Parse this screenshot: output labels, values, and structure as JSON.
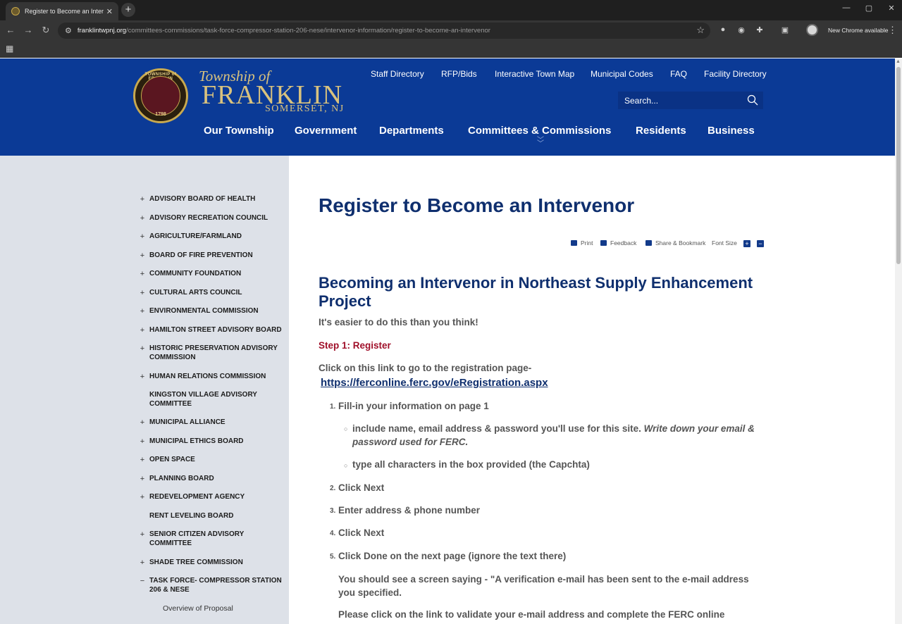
{
  "browser": {
    "tab_title": "Register to Become an Intervenor",
    "url_domain": "franklintwpnj.org",
    "url_path": "/committees-commissions/task-force-compressor-station-206-nese/intervenor-information/register-to-become-an-intervenor",
    "new_chrome_label": "New Chrome available"
  },
  "header": {
    "logo_township": "Township of",
    "logo_franklin": "FRANKLIN",
    "logo_somerset": "SOMERSET, NJ",
    "seal_text": "TOWNSHIP of FRANKLIN",
    "seal_year": "1798",
    "utility_links": [
      "Staff Directory",
      "RFP/Bids",
      "Interactive Town Map",
      "Municipal Codes",
      "FAQ",
      "Facility Directory"
    ],
    "search_placeholder": "Search...",
    "main_nav": [
      "Our Township",
      "Government",
      "Departments",
      "Committees & Commissions",
      "Residents",
      "Business"
    ]
  },
  "sidebar": {
    "items": [
      {
        "label": "ADVISORY BOARD OF HEALTH",
        "marker": "+"
      },
      {
        "label": "ADVISORY RECREATION COUNCIL",
        "marker": "+"
      },
      {
        "label": "AGRICULTURE/FARMLAND",
        "marker": "+"
      },
      {
        "label": "BOARD OF FIRE PREVENTION",
        "marker": "+"
      },
      {
        "label": "COMMUNITY FOUNDATION",
        "marker": "+"
      },
      {
        "label": "CULTURAL ARTS COUNCIL",
        "marker": "+"
      },
      {
        "label": "ENVIRONMENTAL COMMISSION",
        "marker": "+"
      },
      {
        "label": "HAMILTON STREET ADVISORY BOARD",
        "marker": "+"
      },
      {
        "label": "HISTORIC PRESERVATION ADVISORY COMMISSION",
        "marker": "+"
      },
      {
        "label": "HUMAN RELATIONS COMMISSION",
        "marker": "+"
      },
      {
        "label": "KINGSTON VILLAGE ADVISORY COMMITTEE",
        "marker": ""
      },
      {
        "label": "MUNICIPAL ALLIANCE",
        "marker": "+"
      },
      {
        "label": "MUNICIPAL ETHICS BOARD",
        "marker": "+"
      },
      {
        "label": "OPEN SPACE",
        "marker": "+"
      },
      {
        "label": "PLANNING BOARD",
        "marker": "+"
      },
      {
        "label": "REDEVELOPMENT AGENCY",
        "marker": "+"
      },
      {
        "label": "RENT LEVELING BOARD",
        "marker": ""
      },
      {
        "label": "SENIOR CITIZEN ADVISORY COMMITTEE",
        "marker": "+"
      },
      {
        "label": "SHADE TREE COMMISSION",
        "marker": "+"
      },
      {
        "label": "TASK FORCE- COMPRESSOR STATION 206 & NESE",
        "marker": "−"
      }
    ],
    "sub_item": "Overview of Proposal"
  },
  "page": {
    "title": "Register to Become an Intervenor",
    "tools": {
      "print": "Print",
      "feedback": "Feedback",
      "share": "Share & Bookmark",
      "font_size": "Font Size",
      "plus": "+",
      "minus": "−"
    },
    "heading": "Becoming an Intervenor in Northeast Supply Enhancement Project",
    "intro": "It's easier to do this than you think!",
    "step1": "Step 1: Register",
    "click_link_text": "Click on this link to go to the registration page-",
    "registration_url": "https://ferconline.ferc.gov/eRegistration.aspx",
    "steps": [
      "Fill-in your information on page 1",
      "Click Next",
      "Enter address & phone number",
      "Click Next",
      "Click Done on the next page (ignore the text there)"
    ],
    "step_numbers": [
      "1.",
      "2.",
      "3.",
      "4.",
      "5."
    ],
    "sub_bullet_1": "include name, email address & password you'll use for this site. ",
    "sub_bullet_1_italic": "Write down your email & password used for FERC.",
    "sub_bullet_2": "type all characters in the box provided (the Capchta)",
    "verification_text": "You should see a screen saying - \"A verification e-mail has been sent to the e-mail address you specified.",
    "validate_text": "Please click on the link to validate your e-mail address and complete the FERC online"
  }
}
